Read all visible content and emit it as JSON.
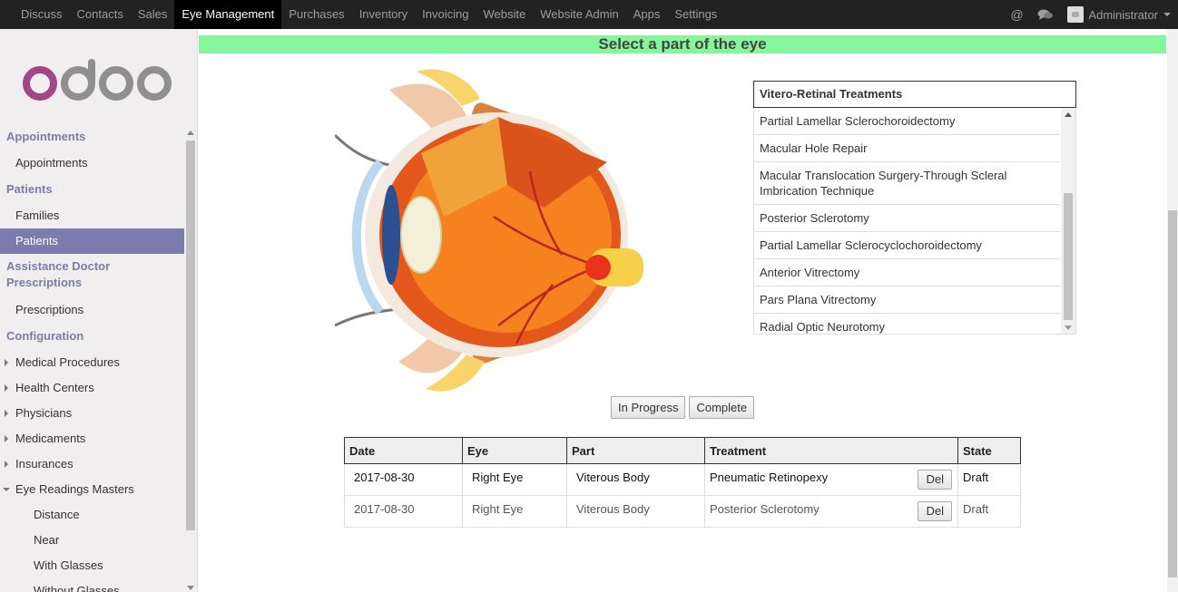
{
  "topbar": {
    "menu": [
      "Discuss",
      "Contacts",
      "Sales",
      "Eye Management",
      "Purchases",
      "Inventory",
      "Invoicing",
      "Website",
      "Website Admin",
      "Apps",
      "Settings"
    ],
    "active": "Eye Management",
    "user": "Administrator",
    "icons": [
      "at-icon",
      "chat-icon"
    ]
  },
  "sidebar": {
    "logo": "odoo",
    "appointments_header": "Appointments",
    "appointments": "Appointments",
    "patients_header": "Patients",
    "families": "Families",
    "patients": "Patients",
    "assist_header": "Assistance Doctor Prescriptions",
    "prescriptions": "Prescriptions",
    "config_header": "Configuration",
    "config_items": [
      "Medical Procedures",
      "Health Centers",
      "Physicians",
      "Medicaments",
      "Insurances",
      "Eye Readings Masters"
    ],
    "readings_sub": [
      "Distance",
      "Near",
      "With Glasses",
      "Without Glasses"
    ]
  },
  "main": {
    "banner": "Select a part of the eye",
    "treatments": {
      "title": "Vitero-Retinal Treatments",
      "items": [
        "Partial Lamellar Sclerochoroidectomy",
        "Macular Hole Repair",
        "Macular Translocation Surgery-Through Scleral Imbrication Technique",
        "Posterior Sclerotomy",
        "Partial Lamellar Sclerocyclochoroidectomy",
        "Anterior Vitrectomy",
        "Pars Plana Vitrectomy",
        "Radial Optic Neurotomy"
      ]
    },
    "buttons": {
      "in_progress": "In Progress",
      "complete": "Complete"
    },
    "table": {
      "headers": [
        "Date",
        "Eye",
        "Part",
        "Treatment",
        "State"
      ],
      "rows": [
        {
          "date": "2017-08-30",
          "eye": "Right Eye",
          "part": "Viterous Body",
          "treatment": "Pneumatic Retinopexy",
          "state": "Draft"
        },
        {
          "date": "2017-08-30",
          "eye": "Right Eye",
          "part": "Viterous Body",
          "treatment": "Posterior Sclerotomy",
          "state": "Draft"
        }
      ],
      "del_label": "Del"
    }
  }
}
